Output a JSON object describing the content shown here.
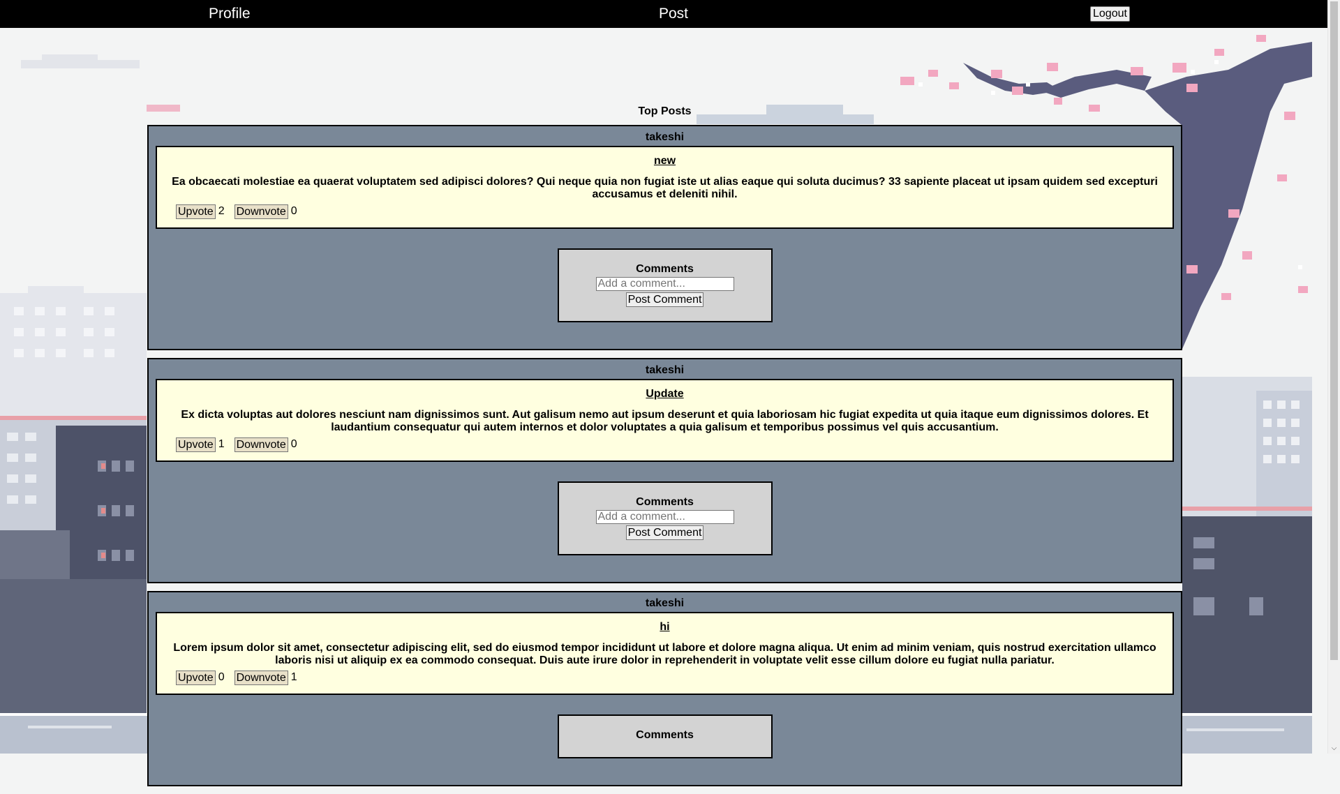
{
  "nav": {
    "profile_label": "Profile",
    "post_label": "Post",
    "logout_label": "Logout"
  },
  "page": {
    "heading": "Top Posts"
  },
  "comments_ui": {
    "title": "Comments",
    "placeholder": "Add a comment...",
    "button_label": "Post Comment"
  },
  "votes_ui": {
    "upvote_label": "Upvote",
    "downvote_label": "Downvote"
  },
  "posts": [
    {
      "author": "takeshi",
      "title": "new",
      "body": "Ea obcaecati molestiae ea quaerat voluptatem sed adipisci dolores? Qui neque quia non fugiat iste ut alias eaque qui soluta ducimus? 33 sapiente placeat ut ipsam quidem sed excepturi accusamus et deleniti nihil.",
      "upvotes": "2",
      "downvotes": "0"
    },
    {
      "author": "takeshi",
      "title": "Update",
      "body": "Ex dicta voluptas aut dolores nesciunt nam dignissimos sunt. Aut galisum nemo aut ipsum deserunt et quia laboriosam hic fugiat expedita ut quia itaque eum dignissimos dolores. Et laudantium consequatur qui autem internos et dolor voluptates a quia galisum et temporibus possimus vel quis accusantium.",
      "upvotes": "1",
      "downvotes": "0"
    },
    {
      "author": "takeshi",
      "title": "hi",
      "body": "Lorem ipsum dolor sit amet, consectetur adipiscing elit, sed do eiusmod tempor incididunt ut labore et dolore magna aliqua. Ut enim ad minim veniam, quis nostrud exercitation ullamco laboris nisi ut aliquip ex ea commodo consequat. Duis aute irure dolor in reprehenderit in voluptate velit esse cillum dolore eu fugiat nulla pariatur.",
      "upvotes": "0",
      "downvotes": "1"
    }
  ],
  "colors": {
    "navbar": "#000000",
    "card": "#7a8898",
    "post_body": "#ffffe0",
    "comments_box": "#d3d3d3",
    "page_bg": "#f3f4f4"
  }
}
